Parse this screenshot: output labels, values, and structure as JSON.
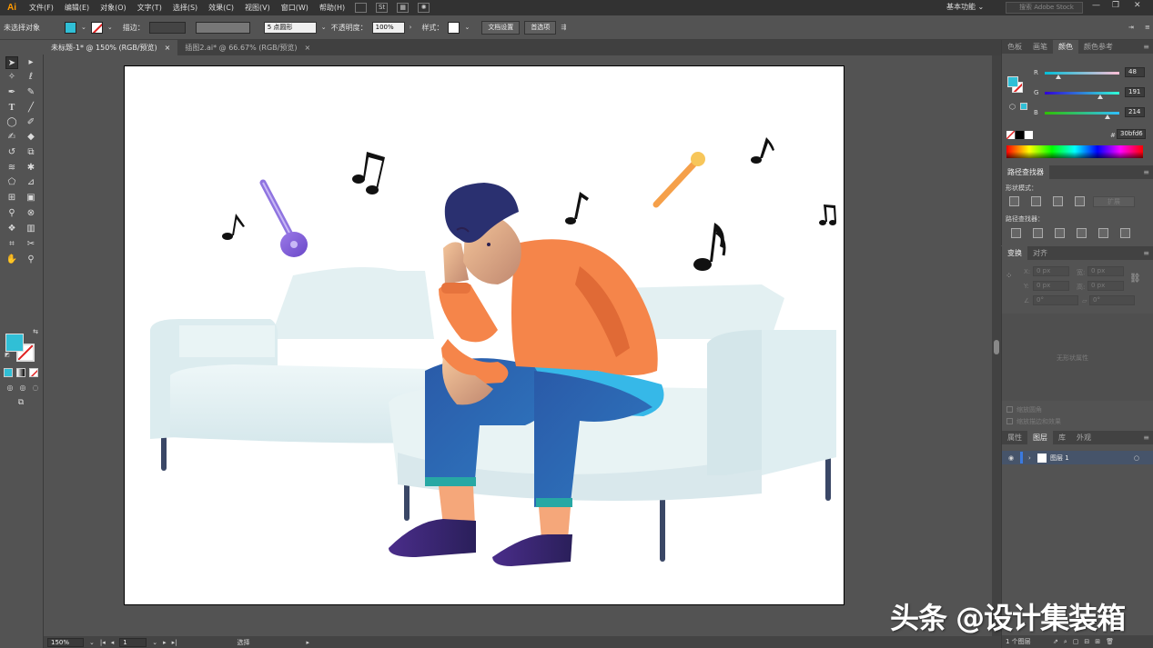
{
  "app": {
    "logo": "Ai"
  },
  "menu": [
    "文件(F)",
    "编辑(E)",
    "对象(O)",
    "文字(T)",
    "选择(S)",
    "效果(C)",
    "视图(V)",
    "窗口(W)",
    "帮助(H)"
  ],
  "menu_icon_st": "St",
  "workspace": "基本功能",
  "stock_search": {
    "placeholder": "搜索 Adobe Stock"
  },
  "control": {
    "selection_state": "未选择对象",
    "fill_color": "#30bfd6",
    "stroke_label": "描边：",
    "brush_value": "5 点圆形",
    "opacity_label": "不透明度：",
    "opacity_value": "100%",
    "style_label": "样式：",
    "doc_setup": "文档设置",
    "preferences": "首选项"
  },
  "tabs": [
    {
      "label": "未标题-1* @ 150% (RGB/预览)",
      "close": "×",
      "active": true
    },
    {
      "label": "插图2.ai* @ 66.67% (RGB/预览)",
      "close": "×",
      "active": false
    }
  ],
  "status": {
    "zoom": "150%",
    "page": "1",
    "tool": "选择"
  },
  "color_panel": {
    "tabs": [
      "色板",
      "画笔",
      "颜色",
      "颜色参考"
    ],
    "active_tab": "颜色",
    "r_label": "R",
    "g_label": "G",
    "b_label": "B",
    "r": "48",
    "g": "191",
    "b": "214",
    "r_frac": 0.188,
    "g_frac": 0.749,
    "b_frac": 0.839,
    "hex_label": "#",
    "hex": "30bfd6"
  },
  "pathfinder": {
    "title": "路径查找器",
    "shape_modes": "形状模式：",
    "expand": "扩展",
    "pathfinders": "路径查找器："
  },
  "transform": {
    "tabs": [
      "变换",
      "对齐"
    ],
    "x_label": "X:",
    "y_label": "Y:",
    "w_label": "宽:",
    "h_label": "高:",
    "x": "0 px",
    "y": "0 px",
    "w": "0 px",
    "h": "0 px",
    "angle": "0°",
    "shear": "0°",
    "no_state": "无形状属性",
    "scale_corners": "缩放圆角",
    "scale_strokes": "缩放描边和效果"
  },
  "layers": {
    "tabs": [
      "属性",
      "图层",
      "库",
      "外观"
    ],
    "active_tab": "图层",
    "layer_name": "图层 1",
    "count": "1 个图层"
  },
  "watermark": "头条 @设计集装箱",
  "colors": {
    "accent": "#30bfd6",
    "orange": "#f5854a",
    "jeans": "#2b63b0",
    "sofa": "#e3f0f2",
    "guitar": "#7b5bd6",
    "mic": "#f5a04a"
  }
}
